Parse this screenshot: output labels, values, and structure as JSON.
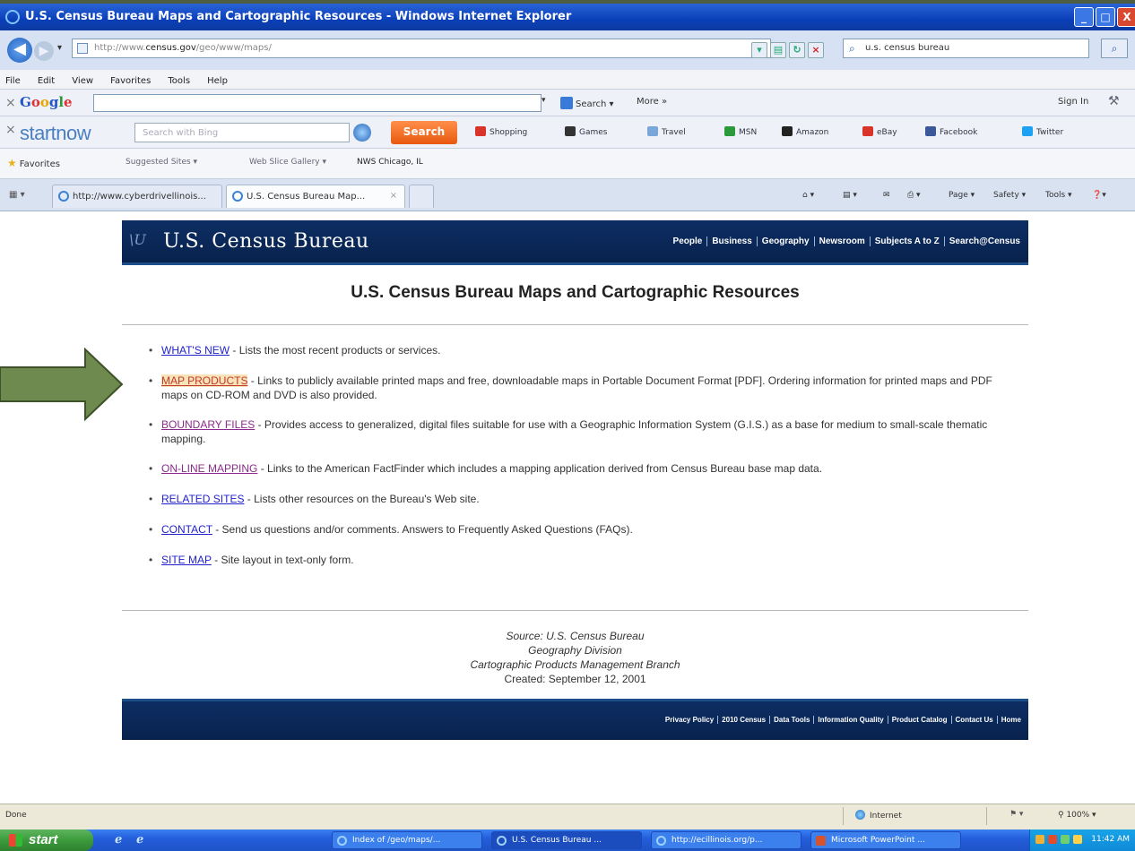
{
  "window": {
    "title": "U.S. Census Bureau Maps and Cartographic Resources - Windows Internet Explorer",
    "minimize_label": "_",
    "maximize_label": "□",
    "close_label": "X"
  },
  "address": {
    "url_prefix": "http://www.",
    "url_domain": "census.gov",
    "url_path": "/geo/www/maps/",
    "search_value": "u.s. census bureau",
    "back_glyph": "◀",
    "forward_glyph": "▶",
    "dropdown_glyph": "▾",
    "search_glyph": "⌕"
  },
  "menubar": [
    "File",
    "Edit",
    "View",
    "Favorites",
    "Tools",
    "Help"
  ],
  "google_toolbar": {
    "close_glyph": "×",
    "logo": [
      "G",
      "o",
      "o",
      "g",
      "l",
      "e"
    ],
    "search_label": "Search ▾",
    "more_label": "More »",
    "signin_label": "Sign In",
    "wrench_glyph": "⚒"
  },
  "startnow_toolbar": {
    "close_glyph": "×",
    "logo": "startnow",
    "search_placeholder": "Search with Bing",
    "search_button": "Search",
    "links": [
      {
        "label": "Shopping",
        "color": "#d9342b"
      },
      {
        "label": "Games",
        "color": "#333333"
      },
      {
        "label": "Travel",
        "color": "#7aa7d9"
      },
      {
        "label": "MSN",
        "color": "#2a9a3a"
      },
      {
        "label": "Amazon",
        "color": "#222222"
      },
      {
        "label": "eBay",
        "color": "#d9342b"
      },
      {
        "label": "Facebook",
        "color": "#3b5998"
      },
      {
        "label": "Twitter",
        "color": "#1da1f2"
      }
    ]
  },
  "favorites_bar": {
    "favorites_label": "Favorites",
    "items": [
      {
        "label": "Suggested Sites ▾"
      },
      {
        "label": "Web Slice Gallery ▾"
      },
      {
        "label": "NWS Chicago, IL"
      }
    ]
  },
  "tabs": {
    "items": [
      {
        "label": "http://www.cyberdrivellinois..."
      },
      {
        "label": "U.S. Census Bureau Map..."
      }
    ],
    "close_glyph": "×",
    "commands": [
      "Page ▾",
      "Safety ▾",
      "Tools ▾"
    ]
  },
  "page": {
    "header_logo_mark": "\\U",
    "header_title": "U.S. Census Bureau",
    "header_nav": [
      "People",
      "Business",
      "Geography",
      "Newsroom",
      "Subjects A to Z",
      "Search@Census"
    ],
    "title": "U.S. Census Bureau Maps and Cartographic Resources",
    "resources": [
      {
        "link": "WHAT'S NEW",
        "desc": " - Lists the most recent products or services."
      },
      {
        "link": "MAP PRODUCTS",
        "desc": " - Links to publicly available printed maps and free, downloadable maps in Portable Document Format [PDF]. Ordering information for printed maps and PDF maps on CD-ROM and DVD is also provided."
      },
      {
        "link": "BOUNDARY FILES",
        "desc": " - Provides access to generalized, digital files suitable for use with a Geographic Information System (G.I.S.) as a base for medium to small-scale thematic mapping."
      },
      {
        "link": "ON-LINE MAPPING",
        "desc": " - Links to the American FactFinder which includes a mapping application derived from Census Bureau base map data."
      },
      {
        "link": "RELATED SITES",
        "desc": " - Lists other resources on the Bureau's Web site."
      },
      {
        "link": "CONTACT",
        "desc": " - Send us questions and/or comments. Answers to Frequently Asked Questions (FAQs)."
      },
      {
        "link": "SITE MAP",
        "desc": " - Site layout in text-only form."
      }
    ],
    "source_lines": [
      "Source: U.S. Census Bureau",
      "Geography Division",
      "Cartographic Products Management Branch"
    ],
    "created": "Created: September 12, 2001",
    "footer_nav": [
      "Privacy Policy",
      "2010 Census",
      "Data Tools",
      "Information Quality",
      "Product Catalog",
      "Contact Us",
      "Home"
    ]
  },
  "statusbar": {
    "text": "Done",
    "zone": "Internet",
    "zoom": "⚲ 100% ▾"
  },
  "taskbar": {
    "start_label": "start",
    "quick_launch": [
      "ℯ",
      "ℯ"
    ],
    "tasks": [
      {
        "label": "Index of /geo/maps/..."
      },
      {
        "label": "U.S. Census Bureau ..."
      },
      {
        "label": "http://ecillinois.org/p..."
      },
      {
        "label": "Microsoft PowerPoint ..."
      }
    ],
    "clock": "11:42 AM"
  },
  "colors": {
    "arrow_fill": "#6e8a4e",
    "arrow_stroke": "#3d5228",
    "census_navy": "#0d2e63"
  }
}
